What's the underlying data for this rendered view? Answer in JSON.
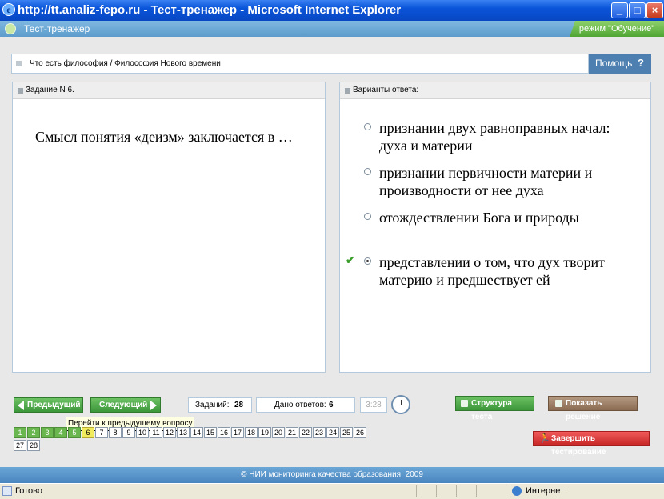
{
  "window": {
    "title": "http://tt.analiz-fepo.ru - Тест-тренажер - Microsoft Internet Explorer",
    "minimize": "_",
    "maximize": "□",
    "close": "×"
  },
  "app": {
    "name": "Тест-тренажер",
    "mode": "режим \"Обучение\""
  },
  "breadcrumb": "Что есть философия / Философия Нового времени",
  "help_label": "Помощь",
  "help_icon": "?",
  "question_panel": {
    "header": "Задание N 6.",
    "text": "Смысл понятия «деизм»  заключается в …"
  },
  "answers_panel": {
    "header": "Варианты ответа:",
    "options": [
      {
        "text": "признании двух равноправных начал: духа и материи",
        "selected": false,
        "correct": false
      },
      {
        "text": "признании первичности материи и производности от нее духа",
        "selected": false,
        "correct": false
      },
      {
        "text": "отождествлении  Бога и природы",
        "selected": false,
        "correct": false
      },
      {
        "text": "представлении о том, что дух творит материю и предшествует ей",
        "selected": true,
        "correct": true
      }
    ]
  },
  "controls": {
    "prev_label": "Предыдущий",
    "next_label": "Следующий",
    "tasks_label": "Заданий:",
    "tasks_value": "28",
    "answered_label": "Дано ответов:",
    "answered_value": "6",
    "timer": "3:28",
    "structure_label": "Структура теста",
    "solution_label": "Показать решение",
    "finish_label": "Завершить тестирование",
    "tooltip": "Перейти к предыдущему вопросу"
  },
  "question_numbers": {
    "items": [
      "1",
      "2",
      "3",
      "4",
      "5",
      "6",
      "7",
      "8",
      "9",
      "10",
      "11",
      "12",
      "13",
      "14",
      "15",
      "16",
      "17",
      "18",
      "19",
      "20",
      "21",
      "22",
      "23",
      "24",
      "25",
      "26",
      "27",
      "28"
    ],
    "answered_count": 5,
    "current": 6
  },
  "footer": "© НИИ мониторинга качества образования, 2009",
  "statusbar": {
    "status": "Готово",
    "zone": "Интернет"
  },
  "colors": {
    "title_bar": "#0a54d9",
    "app_header": "#5d9ccd",
    "mode_badge": "#4fa533",
    "help": "#4d7fb0",
    "green_button": "#3c963a",
    "solution_button": "#8a6b52",
    "finish_button": "#c62525",
    "answered_cell": "#6ab64f",
    "current_cell": "#f1ec5e"
  }
}
